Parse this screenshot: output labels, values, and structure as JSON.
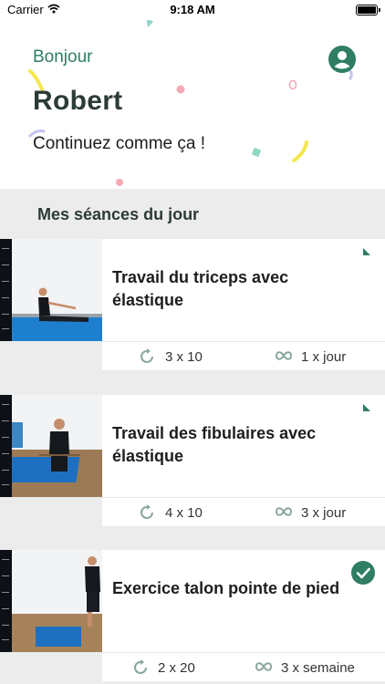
{
  "status_bar": {
    "carrier": "Carrier",
    "time": "9:18 AM"
  },
  "header": {
    "greeting": "Bonjour",
    "username": "Robert",
    "motivation": "Continuez comme ça !"
  },
  "section": {
    "title": "Mes séances du jour"
  },
  "exercises": [
    {
      "title": "Travail du triceps avec élastique",
      "repetitions": "3 x 10",
      "frequency": "1 x jour",
      "status": "pending"
    },
    {
      "title": "Travail des fibulaires avec élastique",
      "repetitions": "4 x 10",
      "frequency": "3 x jour",
      "status": "pending"
    },
    {
      "title": "Exercice talon pointe de pied",
      "repetitions": "2 x 20",
      "frequency": "3 x semaine",
      "status": "completed"
    }
  ],
  "colors": {
    "accent": "#2f7d64",
    "confetti_yellow": "#f5e84f",
    "confetti_pink": "#f7a9b4",
    "confetti_teal": "#8fd7c7",
    "confetti_lavender": "#c3c4f0"
  },
  "icons": {
    "avatar": "user-avatar-icon",
    "repetitions": "refresh-icon",
    "frequency": "infinity-icon",
    "completed": "checkmark-icon",
    "pending": "flag-icon"
  }
}
